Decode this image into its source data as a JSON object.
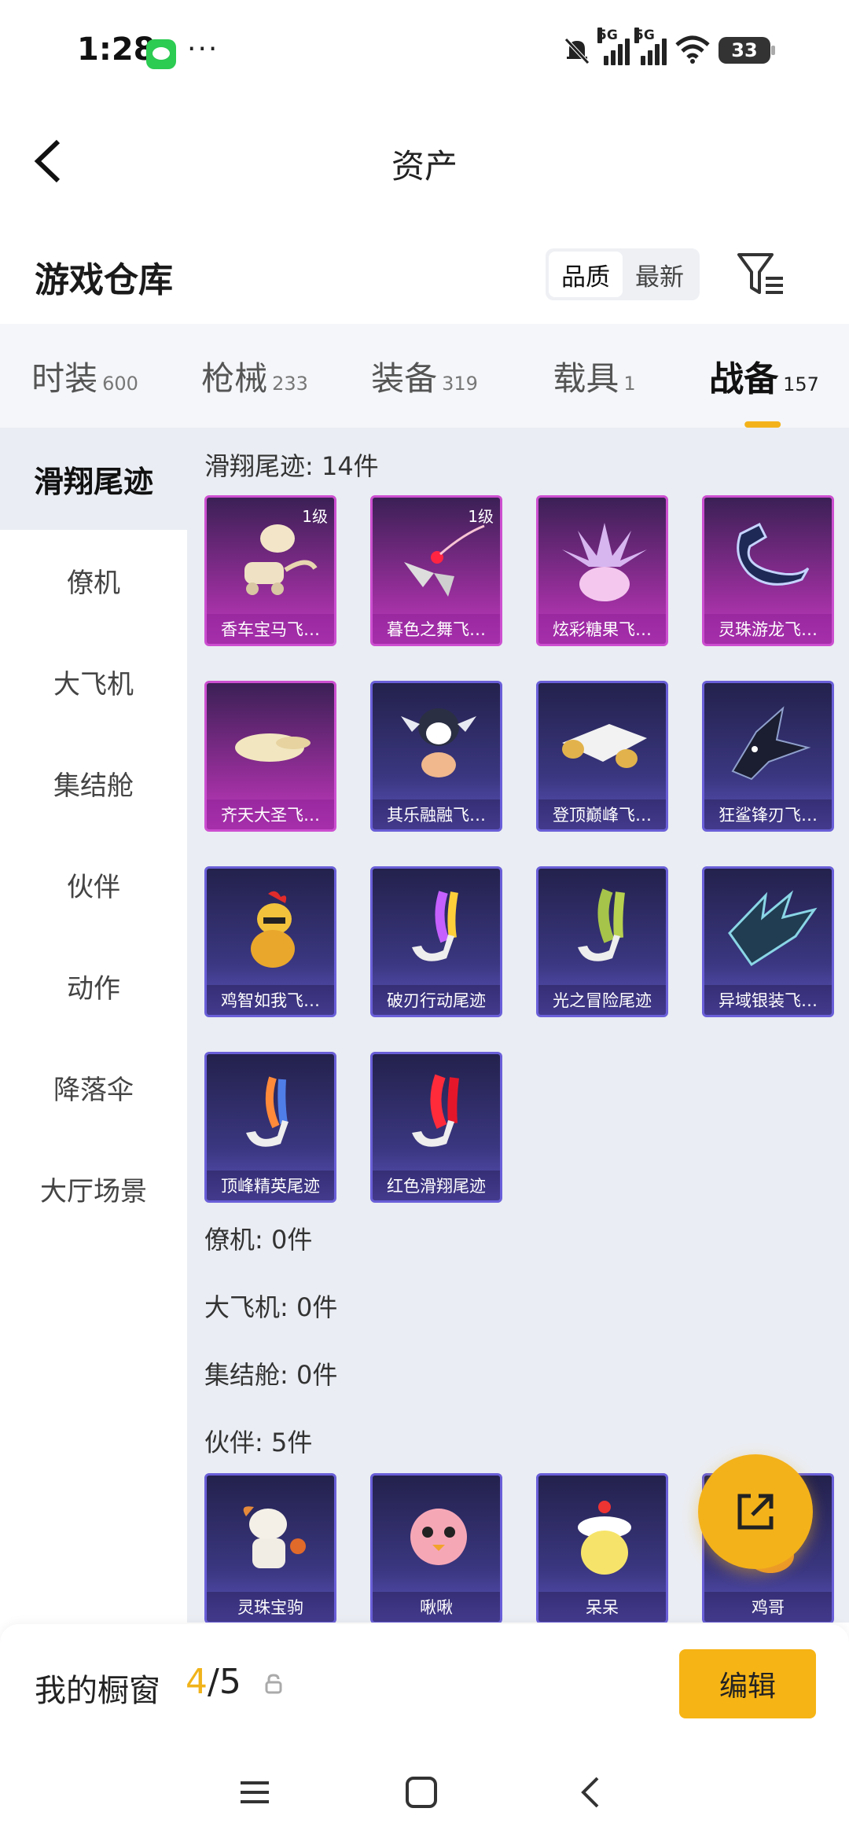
{
  "status_bar": {
    "time": "1:28",
    "dots": "···",
    "network": "5G",
    "battery": "33"
  },
  "header": {
    "title": "资产"
  },
  "warehouse": {
    "title": "游戏仓库",
    "sort_options": [
      "品质",
      "最新"
    ],
    "selected_sort": "品质"
  },
  "tabs": [
    {
      "label": "时装",
      "count": "600"
    },
    {
      "label": "枪械",
      "count": "233"
    },
    {
      "label": "装备",
      "count": "319"
    },
    {
      "label": "载具",
      "count": "1"
    },
    {
      "label": "战备",
      "count": "157",
      "active": true
    }
  ],
  "sidebar": {
    "items": [
      "滑翔尾迹",
      "僚机",
      "大飞机",
      "集结舱",
      "伙伴",
      "动作",
      "降落伞",
      "大厅场景"
    ],
    "active": "滑翔尾迹"
  },
  "sections": {
    "glide": {
      "title": "滑翔尾迹: 14件",
      "items": [
        {
          "name": "香车宝马飞…",
          "level": "1级",
          "quality": "purple"
        },
        {
          "name": "暮色之舞飞…",
          "level": "1级",
          "quality": "purple"
        },
        {
          "name": "炫彩糖果飞…",
          "quality": "purple"
        },
        {
          "name": "灵珠游龙飞…",
          "quality": "purple"
        },
        {
          "name": "齐天大圣飞…",
          "quality": "purple"
        },
        {
          "name": "其乐融融飞…",
          "quality": "blue"
        },
        {
          "name": "登顶巅峰飞…",
          "quality": "blue"
        },
        {
          "name": "狂鲨锋刃飞…",
          "quality": "blue"
        },
        {
          "name": "鸡智如我飞…",
          "quality": "blue"
        },
        {
          "name": "破刃行动尾迹",
          "quality": "blue"
        },
        {
          "name": "光之冒险尾迹",
          "quality": "blue"
        },
        {
          "name": "异域银装飞…",
          "quality": "blue"
        },
        {
          "name": "顶峰精英尾迹",
          "quality": "blue"
        },
        {
          "name": "红色滑翔尾迹",
          "quality": "blue"
        }
      ]
    },
    "wingman": {
      "title": "僚机: 0件"
    },
    "plane": {
      "title": "大飞机: 0件"
    },
    "pod": {
      "title": "集结舱: 0件"
    },
    "partner": {
      "title": "伙伴: 5件",
      "items": [
        {
          "name": "灵珠宝驹",
          "quality": "blue"
        },
        {
          "name": "啾啾",
          "quality": "blue"
        },
        {
          "name": "呆呆",
          "quality": "blue"
        },
        {
          "name": "鸡哥",
          "quality": "blue"
        }
      ]
    }
  },
  "bottom_bar": {
    "title": "我的橱窗",
    "current": "4",
    "total": "/5",
    "edit_label": "编辑"
  },
  "colors": {
    "accent": "#f4b21a",
    "purple_card": "#c13fc2",
    "blue_card": "#5d55bf",
    "panel_bg": "#eaedf3"
  }
}
